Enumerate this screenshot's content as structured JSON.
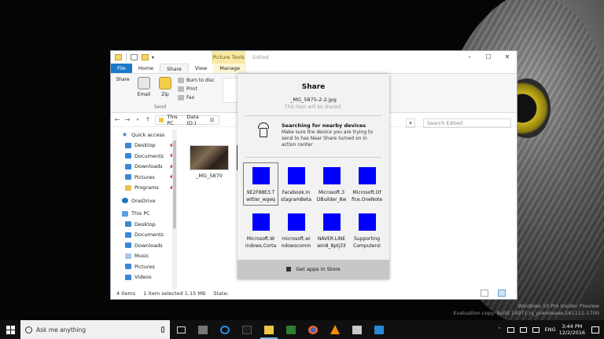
{
  "explorer": {
    "context_tab": "Picture Tools",
    "title": "Edited",
    "ribbon_tabs": [
      "File",
      "Home",
      "Share",
      "View",
      "Manage"
    ],
    "ribbon": {
      "share": "Share",
      "email": "Email",
      "zip": "Zip",
      "burn": "Burn to disc",
      "print": "Print",
      "fax": "Fax",
      "group_label": "Send"
    },
    "address": [
      "This PC",
      "Data (D:)",
      "D"
    ],
    "search_placeholder": "Search Edited",
    "nav": [
      {
        "label": "Quick access",
        "icon": "star-icon",
        "pinned": false
      },
      {
        "label": "Desktop",
        "icon": "desktop-folder-icon",
        "pinned": true
      },
      {
        "label": "Documents",
        "icon": "documents-folder-icon",
        "pinned": true
      },
      {
        "label": "Downloads",
        "icon": "downloads-folder-icon",
        "pinned": true
      },
      {
        "label": "Pictures",
        "icon": "pictures-folder-icon",
        "pinned": true
      },
      {
        "label": "Programs",
        "icon": "folder-icon",
        "pinned": true
      },
      {
        "label": "OneDrive",
        "icon": "onedrive-icon",
        "pinned": false
      },
      {
        "label": "This PC",
        "icon": "this-pc-icon",
        "pinned": false
      },
      {
        "label": "Desktop",
        "icon": "desktop-folder-icon",
        "pinned": false
      },
      {
        "label": "Documents",
        "icon": "documents-folder-icon",
        "pinned": false
      },
      {
        "label": "Downloads",
        "icon": "downloads-folder-icon",
        "pinned": false
      },
      {
        "label": "Music",
        "icon": "music-icon",
        "pinned": false
      },
      {
        "label": "Pictures",
        "icon": "pictures-folder-icon",
        "pinned": false
      },
      {
        "label": "Videos",
        "icon": "videos-folder-icon",
        "pinned": false
      }
    ],
    "file_label": "_MG_5870",
    "status": {
      "items": "4 items",
      "selected": "1 item selected  1.15 MB",
      "state": "State:"
    }
  },
  "share": {
    "title": "Share",
    "file_name": "_MG_5875-2-2.jpg",
    "warning": "This item will be shared.",
    "nearby_heading": "Searching for nearby devices",
    "nearby_text": "Make sure the device you are trying to send to has Near Share turned on in action center",
    "apps": [
      {
        "name": "9E2F88E3.T\nwitter_wgeq",
        "selected": true
      },
      {
        "name": "Facebook.In\nstagramBeta",
        "selected": false
      },
      {
        "name": "Microsoft.3\nDBuilder_8w",
        "selected": false
      },
      {
        "name": "Microsoft.Of\nfice.OneNote",
        "selected": false
      },
      {
        "name": "Microsoft.W\nindows.Corta",
        "selected": false
      },
      {
        "name": "microsoft.wi\nndowscomm",
        "selected": false
      },
      {
        "name": "NAVER.LINE\nwin8_8ptj33",
        "selected": false
      },
      {
        "name": "Supporting\nComputersI",
        "selected": false
      }
    ],
    "tile_color": "#0000ff",
    "get_apps": "Get apps in Store"
  },
  "taskbar": {
    "search_placeholder": "Ask me anything",
    "language": "ENG",
    "time": "3:44 PM",
    "date": "12/2/2016"
  },
  "watermark": {
    "line1": "Windows 10 Pro Insider Preview",
    "line2": "Evaluation copy. Build 14971.rs_prerelease.161111-1700"
  }
}
